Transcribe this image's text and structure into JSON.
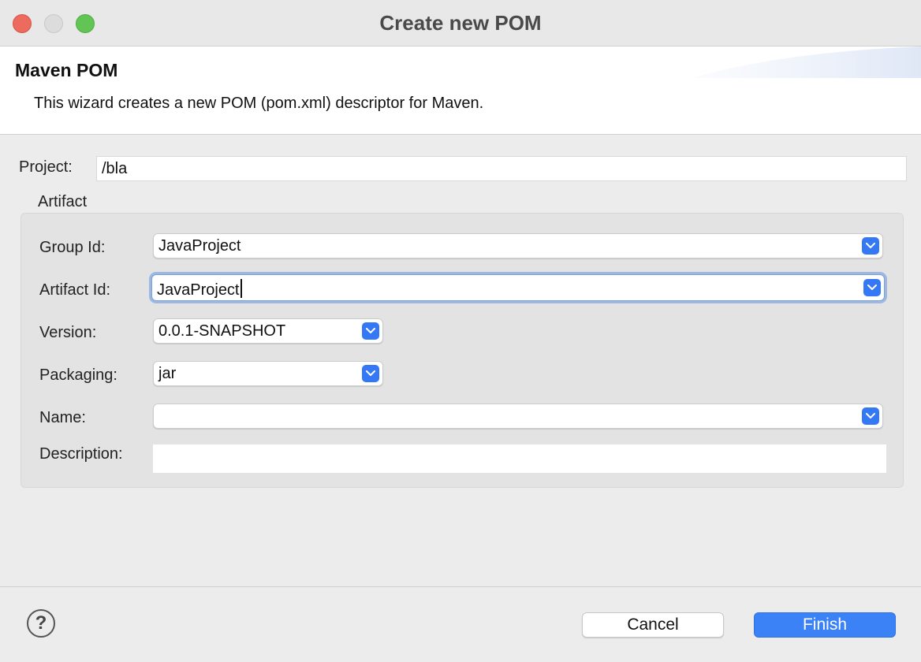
{
  "window": {
    "title": "Create new POM"
  },
  "banner": {
    "heading": "Maven POM",
    "description": "This wizard creates a new POM (pom.xml) descriptor for Maven."
  },
  "form": {
    "project_label": "Project:",
    "project_value": "/bla",
    "artifact_group_label": "Artifact",
    "group_id_label": "Group Id:",
    "group_id_value": "JavaProject",
    "artifact_id_label": "Artifact Id:",
    "artifact_id_value": "JavaProject",
    "version_label": "Version:",
    "version_value": "0.0.1-SNAPSHOT",
    "packaging_label": "Packaging:",
    "packaging_value": "jar",
    "name_label": "Name:",
    "name_value": "",
    "description_label": "Description:",
    "description_value": ""
  },
  "footer": {
    "help_symbol": "?",
    "cancel_label": "Cancel",
    "finish_label": "Finish"
  },
  "colors": {
    "accent": "#3b82f6",
    "close": "#ed6a5e",
    "zoom": "#61c454"
  }
}
